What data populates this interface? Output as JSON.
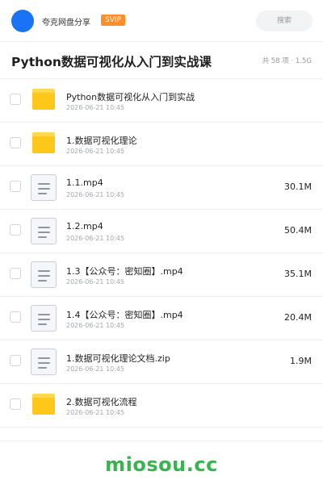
{
  "header": {
    "app_name": "夸克网盘分享",
    "badge": "SVIP",
    "search_label": "搜索"
  },
  "folder": {
    "title": "Python数据可视化从入门到实战课",
    "meta": "共 58 项 · 1.5G"
  },
  "files": [
    {
      "type": "folder",
      "icon": "folder-icon",
      "name": "Python数据可视化从入门到实战",
      "date": "2026-06-21 10:45",
      "size": ""
    },
    {
      "type": "folder",
      "icon": "folder-icon",
      "name": "1.数据可视化理论",
      "date": "2026-06-21 10:45",
      "size": ""
    },
    {
      "type": "file",
      "icon": "file-icon",
      "name": "1.1.mp4",
      "date": "2026-06-21 10:45",
      "size": "30.1M"
    },
    {
      "type": "file",
      "icon": "file-icon",
      "name": "1.2.mp4",
      "date": "2026-06-21 10:45",
      "size": "50.4M"
    },
    {
      "type": "file",
      "icon": "file-icon",
      "name": "1.3【公众号：密知圈】.mp4",
      "date": "2026-06-21 10:45",
      "size": "35.1M"
    },
    {
      "type": "file",
      "icon": "file-icon",
      "name": "1.4【公众号：密知圈】.mp4",
      "date": "2026-06-21 10:45",
      "size": "20.4M"
    },
    {
      "type": "file",
      "icon": "file-icon",
      "name": "1.数据可视化理论文档.zip",
      "date": "2026-06-21 10:45",
      "size": "1.9M"
    },
    {
      "type": "folder",
      "icon": "folder-icon",
      "name": "2.数据可视化流程",
      "date": "2026-06-21 10:45",
      "size": ""
    }
  ],
  "watermark": "miosou.cc",
  "colors": {
    "avatar": "#1a73f5",
    "badge": "#ff8f2a",
    "folder": "#ffc71a",
    "watermark": "#35b64d"
  }
}
